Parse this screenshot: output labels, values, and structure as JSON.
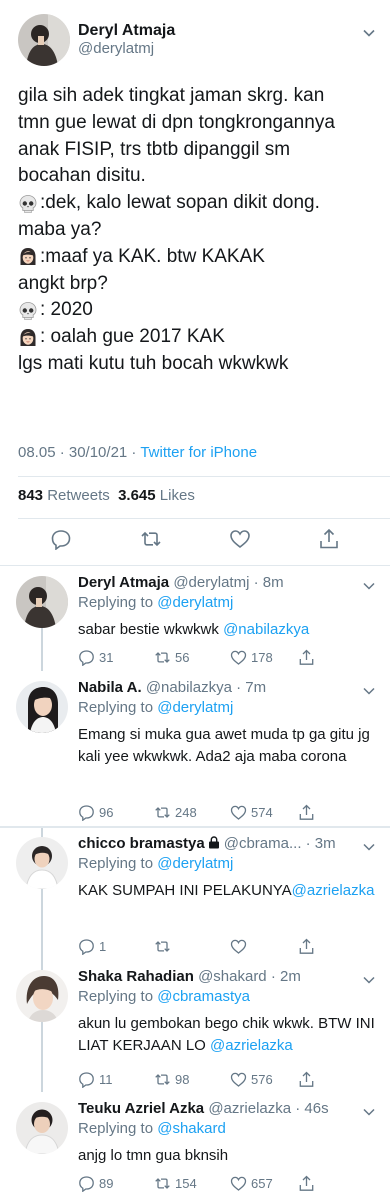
{
  "main_tweet": {
    "name": "Deryl Atmaja",
    "handle": "@derylatmj",
    "lines": [
      {
        "emoji": "",
        "text": "gila sih adek tingkat jaman skrg. kan"
      },
      {
        "emoji": "",
        "text": "tmn gue lewat di dpn tongkrongannya"
      },
      {
        "emoji": "",
        "text": "anak FISIP, trs tbtb dipanggil sm"
      },
      {
        "emoji": "",
        "text": "bocahan disitu."
      },
      {
        "emoji": "skull-emoji",
        "text": ":dek, kalo lewat sopan dikit dong."
      },
      {
        "emoji": "",
        "text": "maba ya?"
      },
      {
        "emoji": "woman-emoji",
        "text": ":maaf ya KAK. btw KAKAK"
      },
      {
        "emoji": "",
        "text": "angkt brp?"
      },
      {
        "emoji": "skull-emoji",
        "text": ": 2020"
      },
      {
        "emoji": "woman-emoji",
        "text": ": oalah gue 2017 KAK"
      },
      {
        "emoji": "",
        "text": "lgs mati kutu tuh bocah wkwkwk"
      }
    ],
    "timestamp": "08.05 · 30/10/21 · ",
    "source": "Twitter for iPhone",
    "retweets_count": "843",
    "retweets_label": "Retweets",
    "likes_count": "3.645",
    "likes_label": "Likes",
    "icons": [
      "reply-icon",
      "retweet-icon",
      "like-icon",
      "share-icon"
    ]
  },
  "replies": [
    {
      "name": "Deryl Atmaja",
      "handle": "@derylatmj · 8m",
      "replying_prefix": "Replying to ",
      "replying_to": "@derylatmj",
      "text": "sabar bestie wkwkwk ",
      "mention": "@nabilazkya",
      "text_after": "",
      "replies": "31",
      "retweets": "56",
      "likes": "178"
    },
    {
      "name": "Nabila A.",
      "handle": "@nabilazkya · 7m",
      "replying_prefix": "Replying to ",
      "replying_to": "@derylatmj",
      "text": "Emang si muka gua awet muda tp ga gitu jg kali yee wkwkwk. Ada2 aja maba corona",
      "mention": "",
      "text_after": "",
      "replies": "96",
      "retweets": "248",
      "likes": "574"
    },
    {
      "name": "chicco bramastya",
      "handle": "@cbrama... · 3m",
      "replying_prefix": "Replying to ",
      "replying_to": "@derylatmj",
      "text": "KAK SUMPAH INI PELAKUNYA",
      "mention": "@azrielazka",
      "text_after": "",
      "replies": "1",
      "retweets": "",
      "likes": ""
    },
    {
      "name": "Shaka Rahadian",
      "handle": "@shakard · 2m",
      "replying_prefix": "Replying to ",
      "replying_to": "@cbramastya",
      "text": "akun lu gembokan bego chik wkwk. BTW INI LIAT KERJAAN LO ",
      "mention": "@azrielazka",
      "text_after": "",
      "replies": "11",
      "retweets": "98",
      "likes": "576"
    },
    {
      "name": "Teuku Azriel Azka",
      "handle": "@azrielazka · 46s",
      "replying_prefix": "Replying to ",
      "replying_to": "@shakard",
      "text": "anjg lo tmn gua bknsih",
      "mention": "",
      "text_after": "",
      "replies": "89",
      "retweets": "154",
      "likes": "657"
    }
  ],
  "colors": {
    "text": "#14171a",
    "secondary": "#657786",
    "link": "#1da1f2",
    "divider": "#e1e8ed",
    "thread_line": "#ccd6dd"
  }
}
